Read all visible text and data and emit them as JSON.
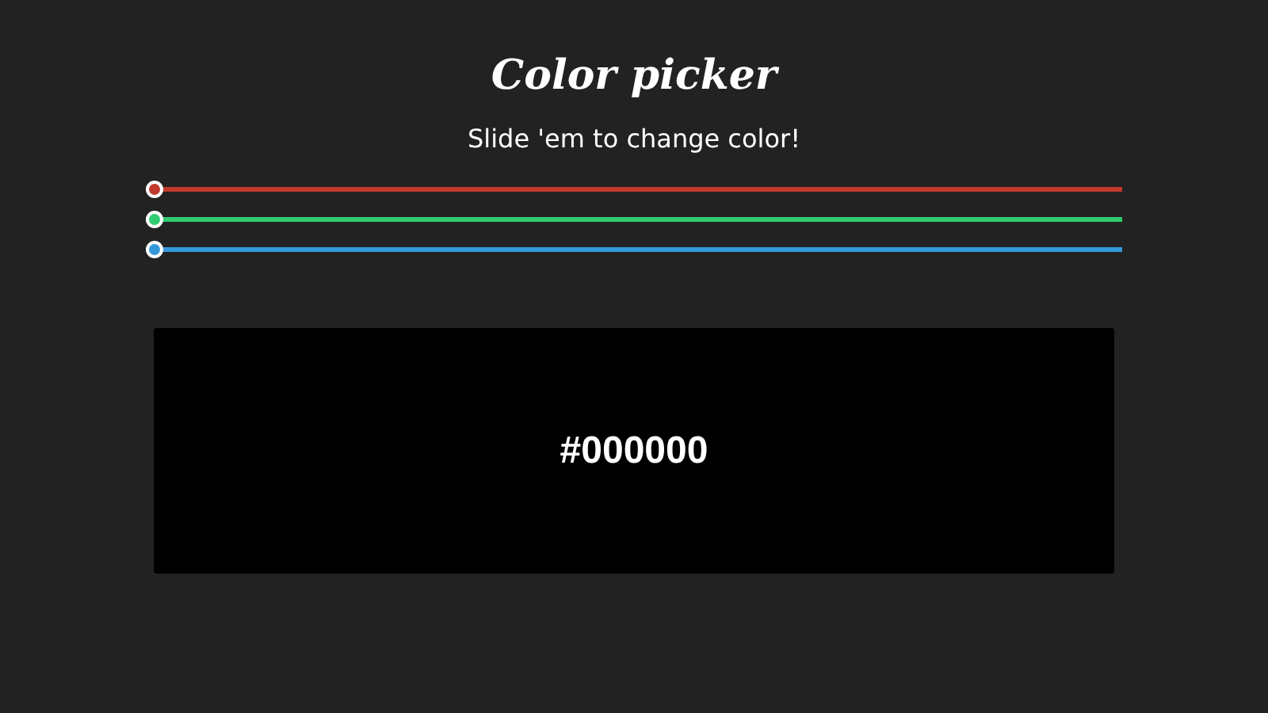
{
  "title": "Color picker",
  "subtitle": "Slide 'em to change color!",
  "sliders": [
    {
      "color": "#c0392b",
      "level": 0
    },
    {
      "color": "#2ecc71",
      "level": 0
    },
    {
      "color": "#3498db",
      "level": 0
    }
  ],
  "swatch": {
    "hex": "#000000"
  }
}
